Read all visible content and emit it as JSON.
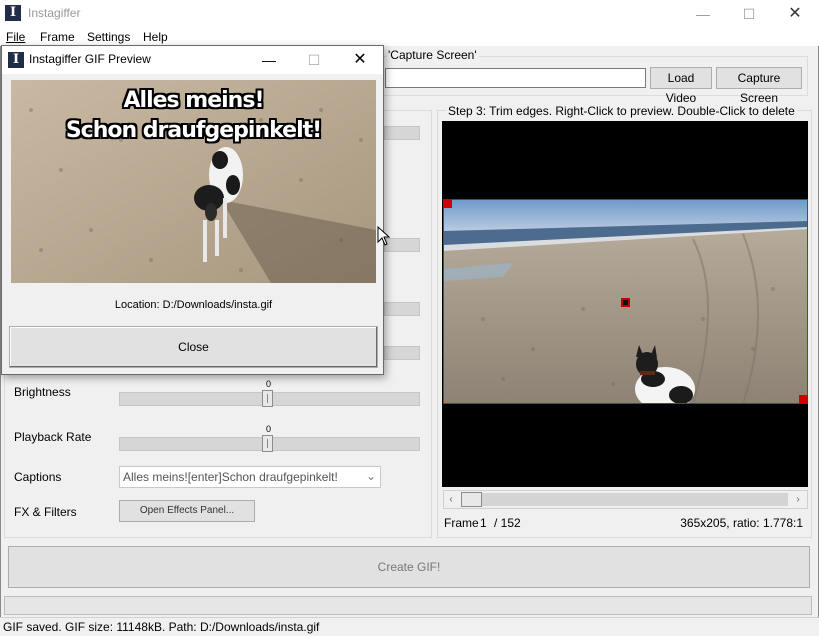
{
  "app": {
    "title": "Instagiffer",
    "icon_letter": "I"
  },
  "window_controls": {
    "minimize": "—",
    "maximize": "☐",
    "close": "✕"
  },
  "menu": [
    {
      "label": "File"
    },
    {
      "label": "Frame"
    },
    {
      "label": "Settings"
    },
    {
      "label": "Help"
    }
  ],
  "step1": {
    "caption_tail": "'Capture Screen'",
    "url_value": "",
    "load_video_label": "Load Video",
    "capture_screen_label": "Capture Screen"
  },
  "settings": {
    "brightness": {
      "label": "Brightness",
      "value": "0",
      "level": 0.5
    },
    "playback_rate": {
      "label": "Playback Rate",
      "value": "0",
      "level": 0.5
    },
    "captions": {
      "label": "Captions",
      "value": "Alles meins![enter]Schon draufgepinkelt!"
    },
    "fx_filters": {
      "label": "FX & Filters",
      "button_label": "Open Effects Panel..."
    }
  },
  "step3": {
    "caption": "Step 3: Trim edges. Right-Click to preview. Double-Click to delete",
    "frame_label": "Frame",
    "frame_current": "1",
    "frame_total": "/ 152",
    "frame_position": 0,
    "dimensions": "365x205, ratio: 1.778:1",
    "scroll_left": "‹",
    "scroll_right": "›"
  },
  "create_gif_label": "Create GIF!",
  "status_text": "GIF saved. GIF size: 11148kB. Path: D:/Downloads/insta.gif",
  "preview_dialog": {
    "title": "Instagiffer GIF Preview",
    "icon_letter": "I",
    "caption_line1": "Alles meins!",
    "caption_line2": "Schon draufgepinkelt!",
    "location": "Location: D:/Downloads/insta.gif",
    "close_label": "Close",
    "controls": {
      "minimize": "—",
      "maximize": "☐",
      "close": "✕"
    }
  },
  "colors": {
    "trim_border": "#e01010",
    "window_bg": "#f0f0f0",
    "button_bg": "#e1e1e1",
    "app_icon": "#1f2d46"
  }
}
